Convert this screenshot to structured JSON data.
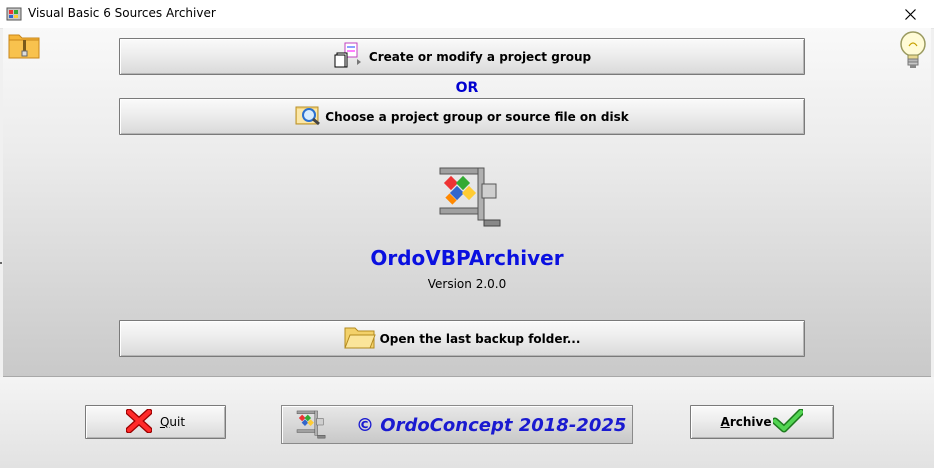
{
  "window": {
    "title": "Visual Basic 6 Sources Archiver",
    "close_glyph": "✕"
  },
  "main": {
    "create_button_label": "Create or modify a project group",
    "or_label": "OR",
    "choose_button_label": "Choose a project group or source file on disk",
    "app_name": "OrdoVBPArchiver",
    "version": "Version 2.0.0",
    "open_backup_label": "Open the last backup folder..."
  },
  "footer": {
    "quit_first": "Q",
    "quit_rest": "uit",
    "copyright": "© OrdoConcept 2018-2025",
    "archive_first": "A",
    "archive_rest": "rchive"
  },
  "icons": {
    "top_left": "zip-folder-icon",
    "top_right": "lightbulb-icon",
    "create": "project-group-icon",
    "choose": "magnifier-search-icon",
    "open": "folder-icon",
    "quit": "red-x-icon",
    "archive": "green-check-icon",
    "logo": "compression-clamp-logo"
  },
  "colors": {
    "accent_blue": "#0a10e0",
    "copyright_blue": "#1a1ad0"
  }
}
